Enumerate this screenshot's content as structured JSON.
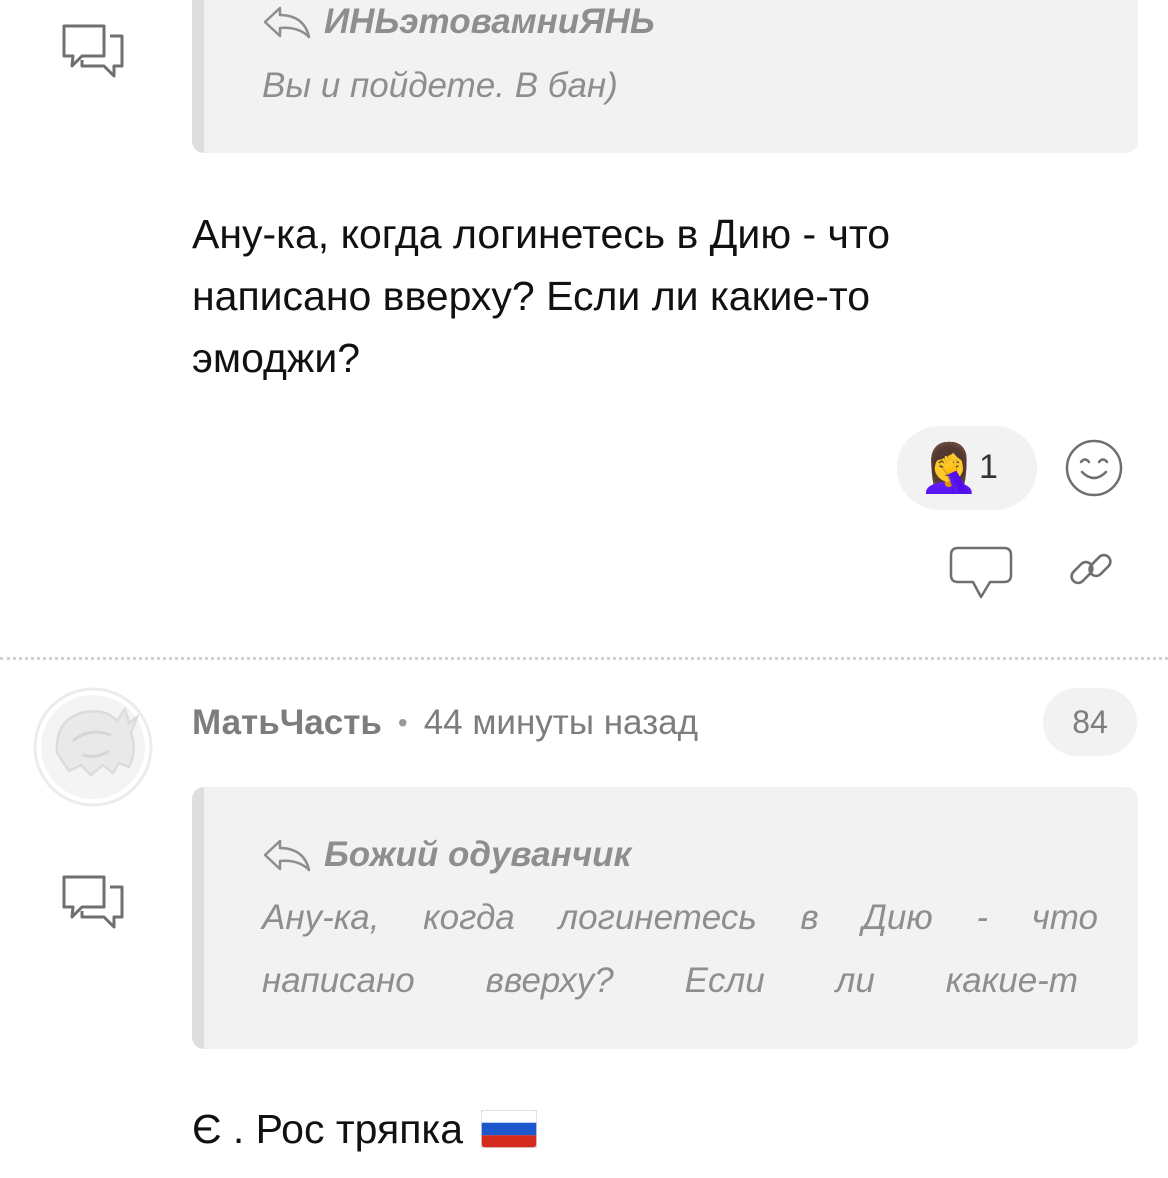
{
  "comment1": {
    "quote": {
      "author": "ИНЬэтовамниЯНЬ",
      "text": "Вы и пойдете. В бан)"
    },
    "body_lines": [
      "Ану-ка, когда логинетесь в Дию - что",
      "написано вверху? Если ли какие-то",
      "эмоджи?"
    ],
    "reactions": [
      {
        "emoji": "🤦‍♀️",
        "count": "1"
      }
    ]
  },
  "comment2": {
    "author": "МатьЧасть",
    "separator": "•",
    "time": "44 минуты назад",
    "rating": "84",
    "quote": {
      "author": "Божий одуванчик",
      "line1_words": [
        "Ану-ка,",
        "когда",
        "логинетесь",
        "в",
        "Дию",
        "-",
        "что"
      ],
      "line2_words": [
        "написано",
        "вверху?",
        "Если",
        "ли",
        "какие-т"
      ]
    },
    "body": "Є . Рос тряпка",
    "body_flag": "🇷🇺"
  },
  "icons": {
    "thread": "thread-bubbles-icon",
    "reply_arrow": "reply-arrow-icon",
    "add_reaction": "smiley-icon",
    "reply": "comment-bubble-icon",
    "link": "link-icon",
    "avatar": "ghost-avatar"
  },
  "colors": {
    "muted_text": "#8e8e8e",
    "quote_bg": "#f2f2f2",
    "quote_border": "#dedede",
    "icon_stroke": "#6f6f6f",
    "flag_white": "#ffffff",
    "flag_blue": "#1c57cc",
    "flag_red": "#d52b1e"
  }
}
